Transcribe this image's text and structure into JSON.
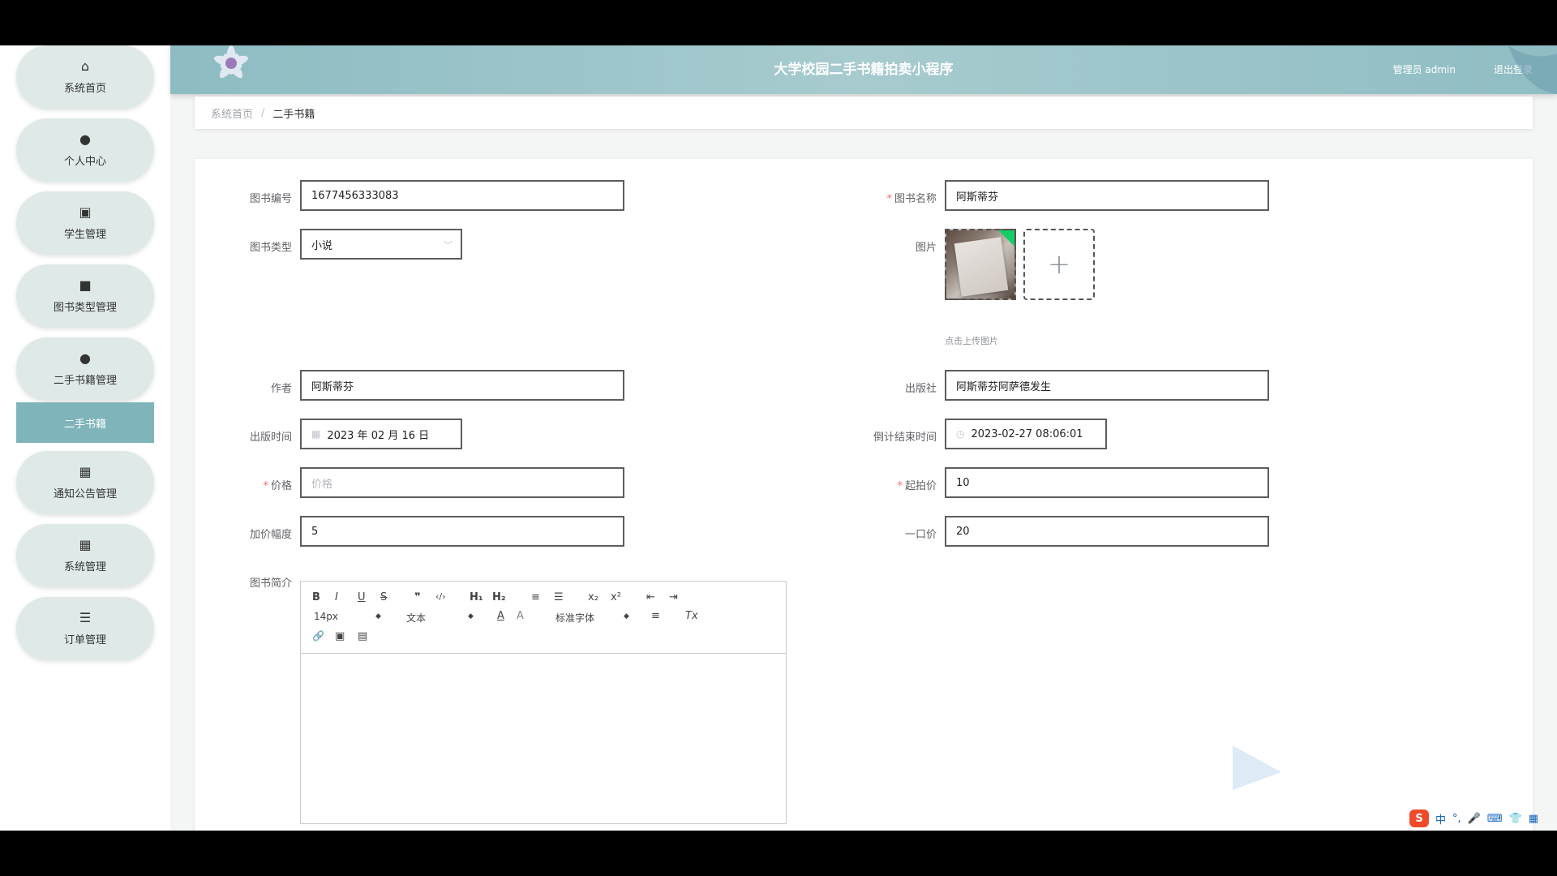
{
  "header": {
    "title": "大学校园二手书籍拍卖小程序",
    "user": "管理员 admin",
    "logout": "退出登录"
  },
  "sidebar": {
    "items": [
      {
        "label": "系统首页",
        "icon": "home-icon"
      },
      {
        "label": "个人中心",
        "icon": "user-icon"
      },
      {
        "label": "学生管理",
        "icon": "student-icon"
      },
      {
        "label": "图书类型管理",
        "icon": "video-icon"
      },
      {
        "label": "二手书籍管理",
        "icon": "user-icon"
      },
      {
        "label": "通知公告管理",
        "icon": "grid-icon"
      },
      {
        "label": "系统管理",
        "icon": "grid-icon"
      },
      {
        "label": "订单管理",
        "icon": "list-icon"
      }
    ],
    "active_sub": "二手书籍"
  },
  "breadcrumb": {
    "home": "系统首页",
    "separator": "/",
    "current": "二手书籍"
  },
  "form": {
    "book_no": {
      "label": "图书编号",
      "value": "1677456333083"
    },
    "book_name": {
      "label": "图书名称",
      "value": "阿斯蒂芬"
    },
    "book_type": {
      "label": "图书类型",
      "value": "小说"
    },
    "image": {
      "label": "图片",
      "hint": "点击上传图片"
    },
    "author": {
      "label": "作者",
      "value": "阿斯蒂芬"
    },
    "publisher": {
      "label": "出版社",
      "value": "阿斯蒂芬阿萨德发生"
    },
    "publish_time": {
      "label": "出版时间",
      "value": "2023 年 02 月 16 日"
    },
    "countdown_end": {
      "label": "倒计结束时间",
      "value": "2023-02-27 08:06:01"
    },
    "price": {
      "label": "价格",
      "placeholder": "价格"
    },
    "start_price": {
      "label": "起拍价",
      "value": "10"
    },
    "increment": {
      "label": "加价幅度",
      "value": "5"
    },
    "buyout": {
      "label": "一口价",
      "value": "20"
    },
    "intro": {
      "label": "图书简介"
    }
  },
  "required_mark": "*",
  "editor": {
    "font_size": "14px",
    "paragraph": "文本",
    "font_family": "标准字体",
    "buttons": {
      "bold": "B",
      "italic": "I",
      "underline": "U",
      "strike": "S",
      "quote": "❞",
      "code": "‹/›",
      "h1": "H₁",
      "h2": "H₂",
      "ordered": "≡",
      "bullet": "☰",
      "sub": "x₂",
      "sup": "x²",
      "outdent": "⇤",
      "indent": "⇥",
      "color": "A",
      "bg": "A",
      "align": "≡",
      "clean": "Tx",
      "link": "🔗",
      "image": "▣",
      "video": "▤"
    }
  },
  "ime": {
    "logo": "S",
    "lang": "中",
    "punct": "°,",
    "mic": "🎤",
    "kbd": "⌨",
    "skin": "👕",
    "menu": "▦"
  },
  "colors": {
    "accent": "#7fb4ba",
    "header": "#9cc4c9",
    "nav_bg": "#dfe9e8"
  }
}
